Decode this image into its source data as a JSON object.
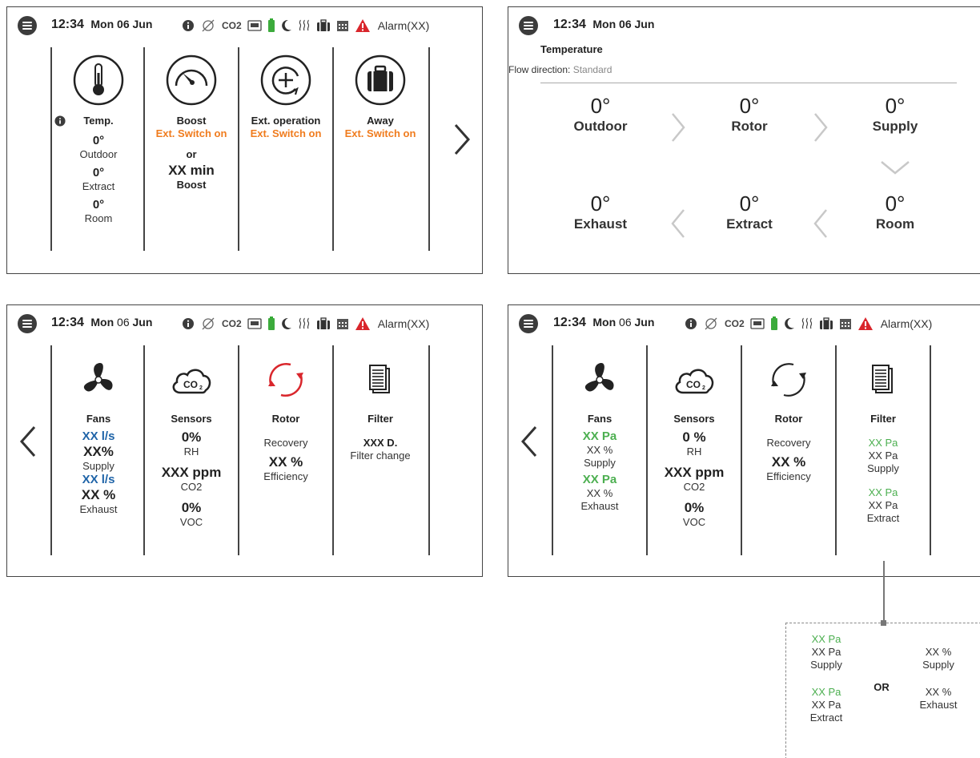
{
  "header": {
    "time": "12:34",
    "day_a": "Mon",
    "date_a": "06",
    "month": "Jun",
    "co2_label": "CO2",
    "alarm": "Alarm(XX)"
  },
  "panel1": {
    "temp": {
      "label": "Temp.",
      "outdoor_val": "0°",
      "outdoor_label": "Outdoor",
      "extract_val": "0°",
      "extract_label": "Extract",
      "room_val": "0°",
      "room_label": "Room"
    },
    "boost": {
      "label": "Boost",
      "switch": "Ext. Switch on",
      "or": "or",
      "minutes": "XX min",
      "boost_sub": "Boost"
    },
    "ext": {
      "label": "Ext. operation",
      "switch": "Ext. Switch on"
    },
    "away": {
      "label": "Away",
      "switch": "Ext. Switch on"
    }
  },
  "panel2": {
    "title": "Temperature",
    "flow_label": "Flow direction:",
    "flow_value": "Standard",
    "cells": {
      "outdoor": {
        "deg": "0°",
        "name": "Outdoor"
      },
      "rotor": {
        "deg": "0°",
        "name": "Rotor"
      },
      "supply": {
        "deg": "0°",
        "name": "Supply"
      },
      "exhaust": {
        "deg": "0°",
        "name": "Exhaust"
      },
      "extract": {
        "deg": "0°",
        "name": "Extract"
      },
      "room": {
        "deg": "0°",
        "name": "Room"
      }
    }
  },
  "panel3": {
    "fans": {
      "label": "Fans",
      "supply_flow": "XX l/s",
      "supply_pct": "XX%",
      "supply": "Supply",
      "exhaust_flow": "XX l/s",
      "exhaust_pct": "XX %",
      "exhaust": "Exhaust"
    },
    "sensors": {
      "label": "Sensors",
      "rh_val": "0%",
      "rh": "RH",
      "co2_val": "XXX ppm",
      "co2": "CO2",
      "voc_val": "0%",
      "voc": "VOC"
    },
    "rotor": {
      "label": "Rotor",
      "recovery": "Recovery",
      "eff_val": "XX %",
      "eff": "Efficiency"
    },
    "filter": {
      "label": "Filter",
      "days": "XXX D.",
      "change": "Filter change"
    }
  },
  "panel4": {
    "fans": {
      "label": "Fans",
      "supply_pa": "XX Pa",
      "supply_pct": "XX %",
      "supply": "Supply",
      "exhaust_pa": "XX Pa",
      "exhaust_pct": "XX %",
      "exhaust": "Exhaust"
    },
    "sensors": {
      "label": "Sensors",
      "rh_val": "0 %",
      "rh": "RH",
      "co2_val": "XXX ppm",
      "co2": "CO2",
      "voc_val": "0%",
      "voc": "VOC"
    },
    "rotor": {
      "label": "Rotor",
      "recovery": "Recovery",
      "eff_val": "XX %",
      "eff": "Efficiency"
    },
    "filter": {
      "label": "Filter",
      "supply_pa_g": "XX Pa",
      "supply_pa": "XX Pa",
      "supply": "Supply",
      "extract_pa_g": "XX Pa",
      "extract_pa": "XX Pa",
      "extract": "Extract"
    }
  },
  "callout": {
    "left_supply_g": "XX Pa",
    "left_supply_pa": "XX Pa",
    "left_supply": "Supply",
    "left_extract_g": "XX Pa",
    "left_extract_pa": "XX Pa",
    "left_extract": "Extract",
    "or": "OR",
    "right_supply_pct": "XX %",
    "right_supply": "Supply",
    "right_exhaust_pct": "XX %",
    "right_exhaust": "Exhaust"
  },
  "colors": {
    "orange": "#f07c1e",
    "blue": "#1f64a8",
    "green": "#4caf50",
    "red": "#d9262c"
  }
}
